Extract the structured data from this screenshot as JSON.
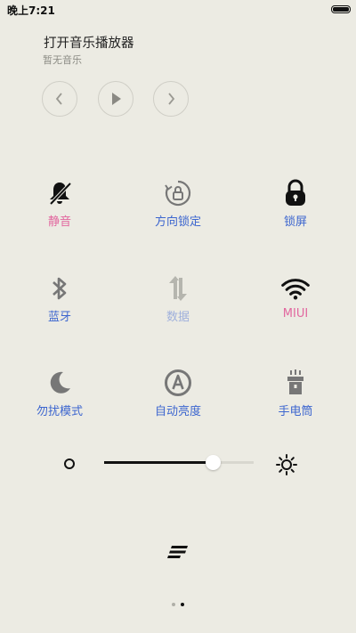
{
  "status_bar": {
    "time": "晚上7:21"
  },
  "music": {
    "title": "打开音乐播放器",
    "subtitle": "暂无音乐"
  },
  "toggles": [
    {
      "id": "mute",
      "label": "静音",
      "icon": "bell-off-icon",
      "active": true
    },
    {
      "id": "rotation-lock",
      "label": "方向锁定",
      "icon": "rotation-lock-icon",
      "active": false
    },
    {
      "id": "lock-screen",
      "label": "锁屏",
      "icon": "lock-icon",
      "active": false
    },
    {
      "id": "bluetooth",
      "label": "蓝牙",
      "icon": "bluetooth-icon",
      "active": false
    },
    {
      "id": "data",
      "label": "数据",
      "icon": "data-sync-icon",
      "active": false,
      "disabled": true
    },
    {
      "id": "wifi",
      "label": "MIUI",
      "icon": "wifi-icon",
      "active": true
    },
    {
      "id": "dnd",
      "label": "勿扰模式",
      "icon": "moon-icon",
      "active": false
    },
    {
      "id": "auto-brightness",
      "label": "自动亮度",
      "icon": "auto-brightness-icon",
      "active": false
    },
    {
      "id": "flashlight",
      "label": "手电筒",
      "icon": "flashlight-icon",
      "active": false
    }
  ],
  "brightness": {
    "level": 0.73
  },
  "pager": {
    "count": 2,
    "current": 1
  },
  "colors": {
    "background": "#ecebe3",
    "active_label": "#e2679f",
    "inactive_label": "#3d66cf",
    "disabled_label": "#9fb0dc",
    "icon_dark": "#111111",
    "icon_grey": "#777777",
    "icon_disabled": "#b5b5ae"
  }
}
